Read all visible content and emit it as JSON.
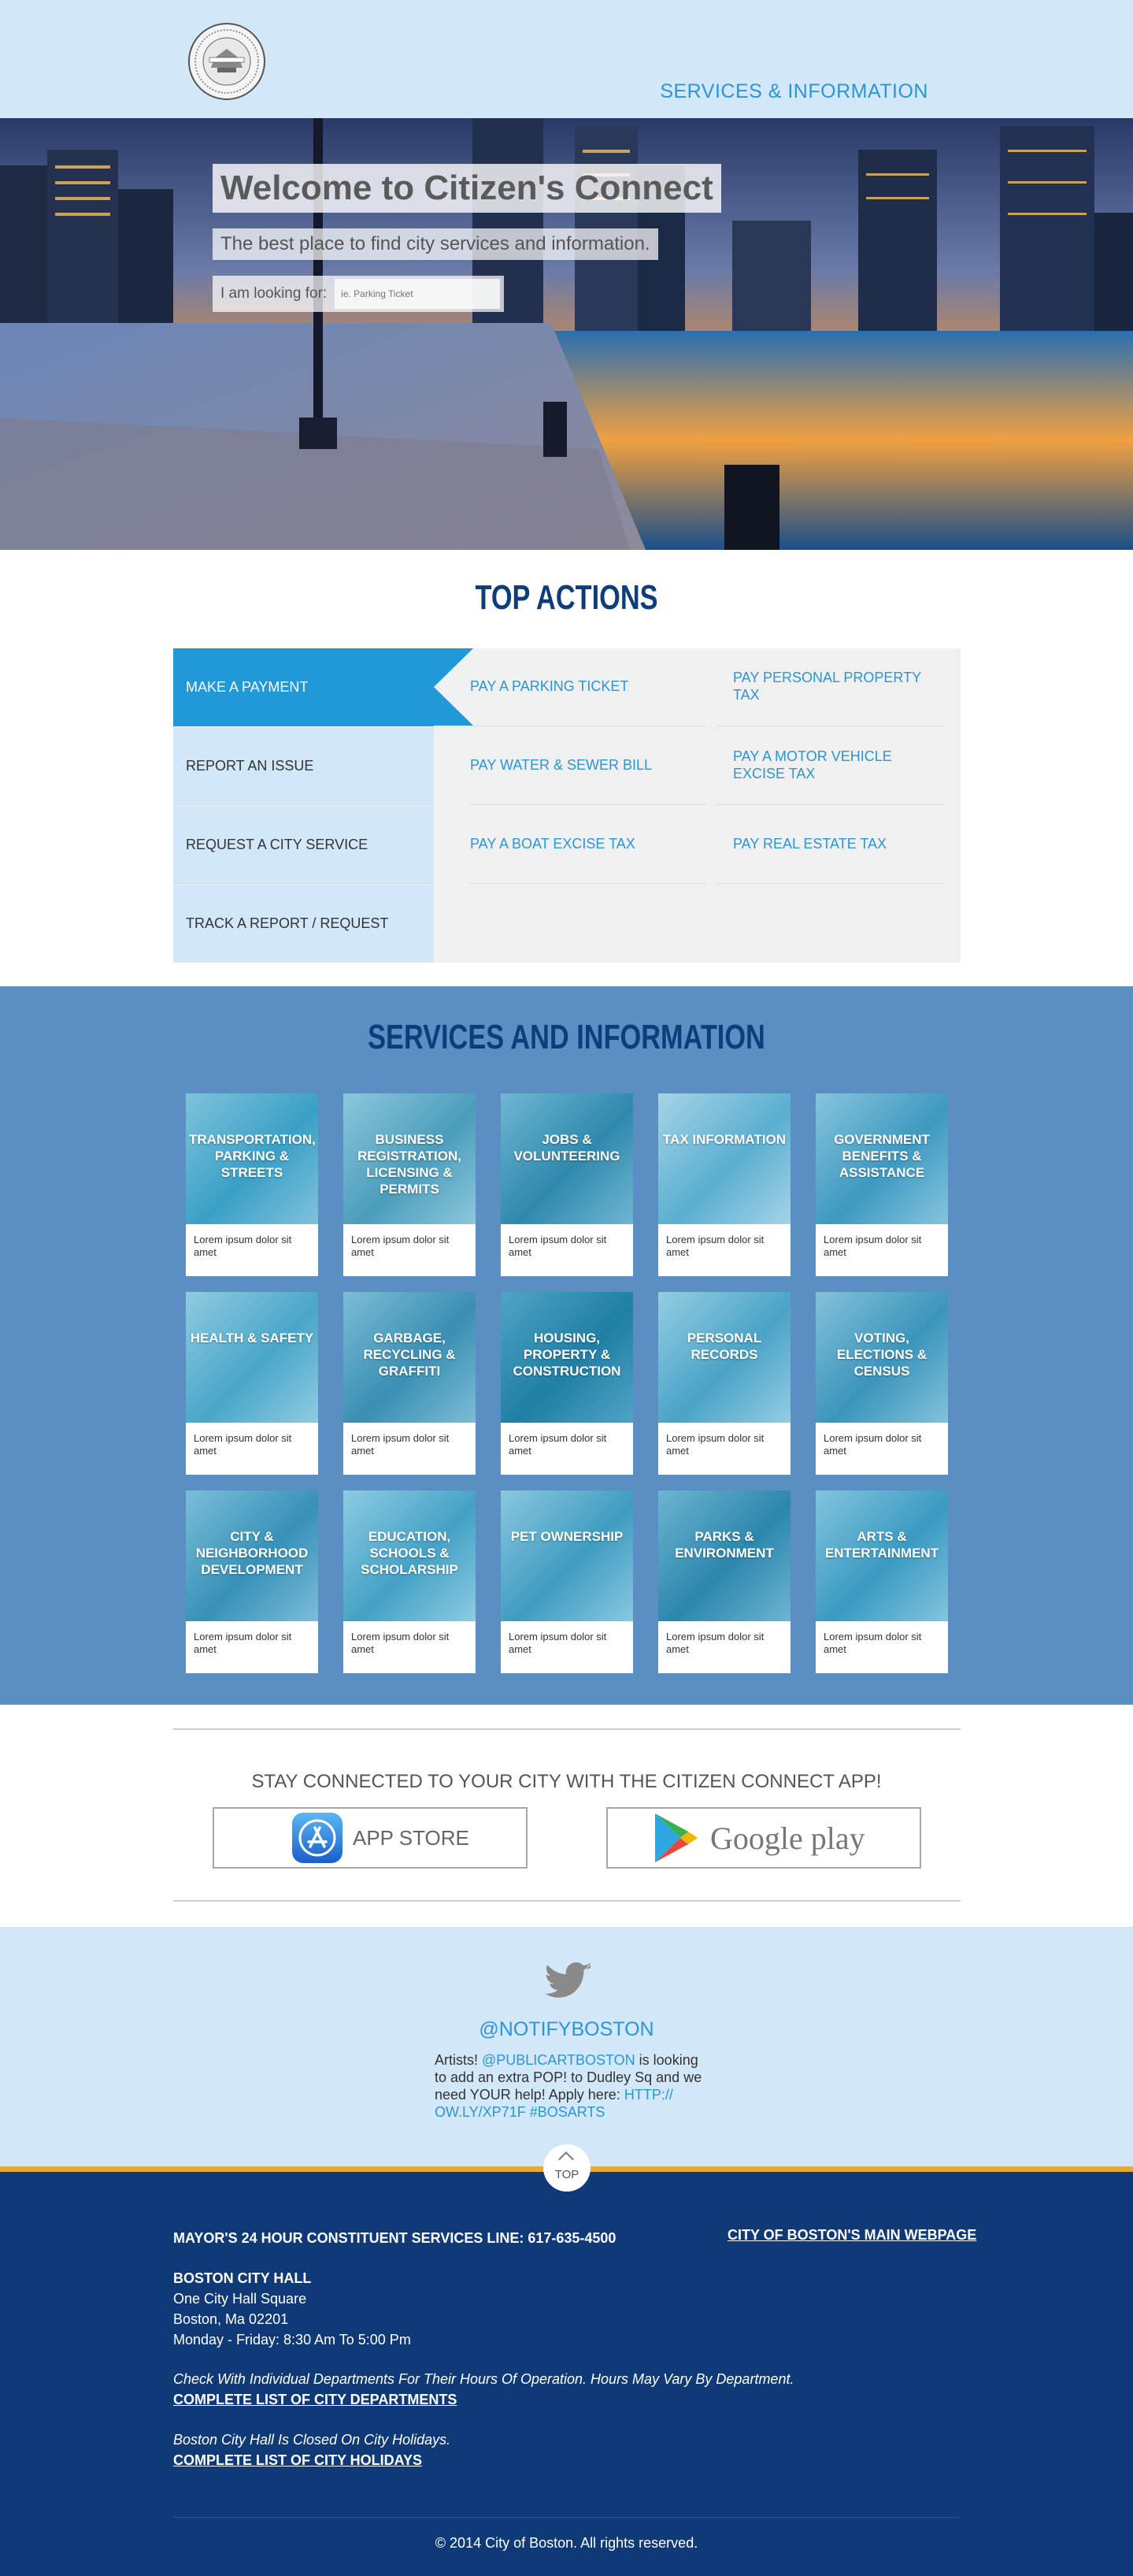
{
  "header": {
    "nav_label": "SERVICES & INFORMATION"
  },
  "hero": {
    "title": "Welcome to Citizen's Connect",
    "subtitle": "The best place to find city services and information.",
    "search_label": "I am looking for:",
    "search_placeholder": "ie. Parking Ticket"
  },
  "top_actions": {
    "title": "TOP ACTIONS",
    "menu": [
      {
        "label": "MAKE A PAYMENT",
        "active": true
      },
      {
        "label": "REPORT AN ISSUE",
        "active": false
      },
      {
        "label": "REQUEST A CITY SERVICE",
        "active": false
      },
      {
        "label": "TRACK A REPORT / REQUEST",
        "active": false
      }
    ],
    "links": [
      "PAY A PARKING TICKET",
      "PAY PERSONAL PROPERTY TAX",
      "PAY WATER & SEWER BILL",
      "PAY A MOTOR VEHICLE EXCISE TAX",
      "PAY A BOAT EXCISE TAX",
      "PAY REAL ESTATE TAX"
    ]
  },
  "services": {
    "title": "SERVICES AND INFORMATION",
    "tiles": [
      {
        "name": "TRANSPORTATION, PARKING & STREETS",
        "desc": "Lorem ipsum dolor sit amet"
      },
      {
        "name": "BUSINESS REGISTRATION, LICENSING & PERMITS",
        "desc": "Lorem ipsum dolor sit amet"
      },
      {
        "name": "JOBS & VOLUNTEERING",
        "desc": "Lorem ipsum dolor sit amet"
      },
      {
        "name": "TAX INFORMATION",
        "desc": "Lorem ipsum dolor sit amet"
      },
      {
        "name": "GOVERNMENT BENEFITS & ASSISTANCE",
        "desc": "Lorem ipsum dolor sit amet"
      },
      {
        "name": "HEALTH & SAFETY",
        "desc": "Lorem ipsum dolor sit amet"
      },
      {
        "name": "GARBAGE, RECYCLING & GRAFFITI",
        "desc": "Lorem ipsum dolor sit amet"
      },
      {
        "name": "HOUSING, PROPERTY & CONSTRUCTION",
        "desc": "Lorem ipsum dolor sit amet"
      },
      {
        "name": "PERSONAL RECORDS",
        "desc": "Lorem ipsum dolor sit amet"
      },
      {
        "name": "VOTING, ELECTIONS & CENSUS",
        "desc": "Lorem ipsum dolor sit amet"
      },
      {
        "name": "CITY & NEIGHBORHOOD DEVELOPMENT",
        "desc": "Lorem ipsum dolor sit amet"
      },
      {
        "name": "EDUCATION, SCHOOLS & SCHOLARSHIP",
        "desc": "Lorem ipsum dolor sit amet"
      },
      {
        "name": "PET OWNERSHIP",
        "desc": "Lorem ipsum dolor sit amet"
      },
      {
        "name": "PARKS & ENVIRONMENT",
        "desc": "Lorem ipsum dolor sit amet"
      },
      {
        "name": "ARTS & ENTERTAINMENT",
        "desc": "Lorem ipsum dolor sit amet"
      }
    ]
  },
  "apps": {
    "title": "STAY CONNECTED TO YOUR CITY WITH THE CITIZEN CONNECT APP!",
    "app_store_label": "APP STORE",
    "google_play_label": "Google play"
  },
  "twitter": {
    "handle": "@NOTIFYBOSTON",
    "tweet_pre": "Artists! ",
    "tweet_mention": "@PUBLICARTBOSTON",
    "tweet_body": " is looking to add an extra POP! to Dudley Sq and we need YOUR help! Apply here: ",
    "tweet_link": "HTTP:// OW.LY/XP71F #BOSARTS"
  },
  "footer": {
    "top_label": "TOP",
    "hotline": "MAYOR'S 24 HOUR CONSTITUENT SERVICES LINE: 617-635-4500",
    "main_link": "CITY OF BOSTON'S MAIN WEBPAGE",
    "hall_title": "BOSTON CITY HALL",
    "hall_line1": "One City Hall Square",
    "hall_line2": "Boston, Ma 02201",
    "hall_hours": "Monday - Friday: 8:30 Am To 5:00 Pm",
    "dept_note": "Check With Individual Departments For Their Hours Of Operation. Hours May Vary By Department.",
    "dept_link": "COMPLETE LIST OF CITY DEPARTMENTS",
    "holiday_note": "Boston City Hall Is Closed On City Holidays.",
    "holiday_link": "COMPLETE LIST OF CITY HOLIDAYS",
    "copyright": "© 2014 City of Boston. All rights reserved."
  },
  "colors": {
    "header_bg": "#d2e7f8",
    "accent_blue": "#2b95d6",
    "active_blue": "#2199d8",
    "services_bg": "#5b8fc3",
    "heading_navy": "#0e3d7b",
    "footer_navy": "#0f3a77",
    "footer_gold": "#e6a93a"
  },
  "icons": {
    "seal": "city-seal-icon",
    "twitter": "twitter-bird-icon",
    "app_store": "app-store-icon",
    "google_play": "google-play-icon",
    "top": "chevron-up-icon"
  }
}
